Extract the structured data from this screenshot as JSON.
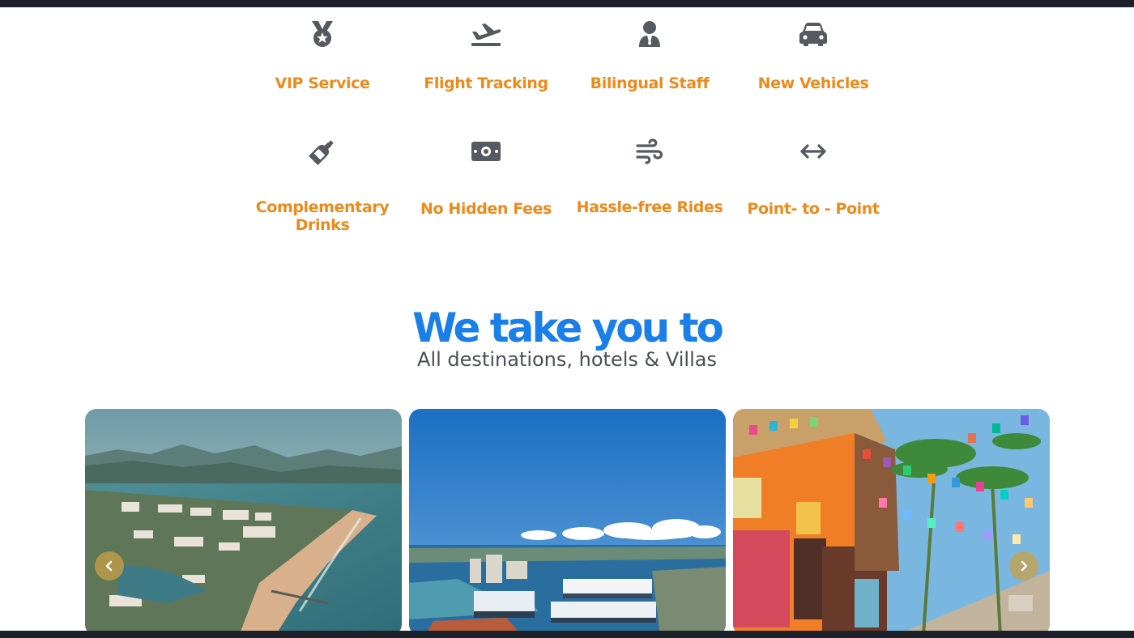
{
  "features": [
    {
      "label": "VIP Service",
      "icon": "medal-icon"
    },
    {
      "label": "Flight Tracking",
      "icon": "plane-departure-icon"
    },
    {
      "label": "Bilingual Staff",
      "icon": "user-tie-icon"
    },
    {
      "label": "New Vehicles",
      "icon": "car-icon"
    },
    {
      "label": "Complementary Drinks",
      "icon": "wine-bottle-icon"
    },
    {
      "label": "No Hidden Fees",
      "icon": "money-bill-icon"
    },
    {
      "label": "Hassle-free Rides",
      "icon": "wind-icon"
    },
    {
      "label": "Point- to - Point",
      "icon": "arrows-left-right-icon"
    }
  ],
  "destinations": {
    "title": "We take you to",
    "subtitle": "All destinations, hotels & Villas",
    "cards": [
      {
        "image": "aerial-coast-marina-photo"
      },
      {
        "image": "cruise-port-bay-photo"
      },
      {
        "image": "colorful-street-papel-picado-photo"
      }
    ],
    "prev_icon": "chevron-left-icon",
    "next_icon": "chevron-right-icon"
  },
  "colors": {
    "accent_orange": "#ec8a1c",
    "heading_blue": "#1a7fe8",
    "subtitle_gray": "#4a4f57",
    "icon_gray": "#555a60",
    "frame_dark": "#1b2029"
  }
}
